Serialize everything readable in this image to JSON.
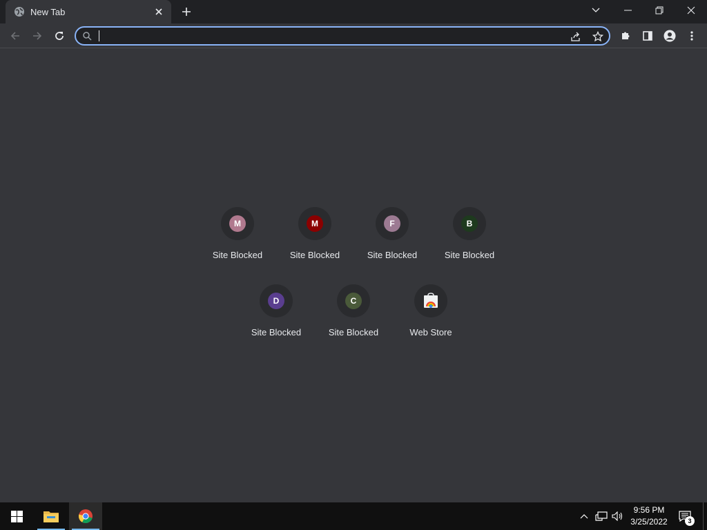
{
  "browser": {
    "tab": {
      "title": "New Tab",
      "favicon": "globe-icon"
    },
    "window_controls": [
      "chevron-down-icon",
      "minimize-icon",
      "restore-icon",
      "close-icon"
    ],
    "omnibox": {
      "value": "",
      "placeholder": ""
    },
    "accent_color": "#8ab4f8"
  },
  "shortcuts": [
    {
      "letter": "M",
      "label": "Site Blocked",
      "color": "#b0798e"
    },
    {
      "letter": "M",
      "label": "Site Blocked",
      "color": "#8b0000"
    },
    {
      "letter": "F",
      "label": "Site Blocked",
      "color": "#9c7a92"
    },
    {
      "letter": "B",
      "label": "Site Blocked",
      "color": "#1e3a1e"
    },
    {
      "letter": "D",
      "label": "Site Blocked",
      "color": "#5a3e8f"
    },
    {
      "letter": "C",
      "label": "Site Blocked",
      "color": "#4a5a3a"
    },
    {
      "letter": "",
      "label": "Web Store",
      "color": "",
      "icon": "web-store-icon"
    }
  ],
  "taskbar": {
    "time": "9:56 PM",
    "date": "3/25/2022",
    "notification_count": "3",
    "apps": [
      "windows-start-icon",
      "file-explorer-icon",
      "chrome-icon"
    ],
    "tray": [
      "chevron-up-icon",
      "network-icon",
      "volume-icon",
      "notification-icon"
    ]
  }
}
